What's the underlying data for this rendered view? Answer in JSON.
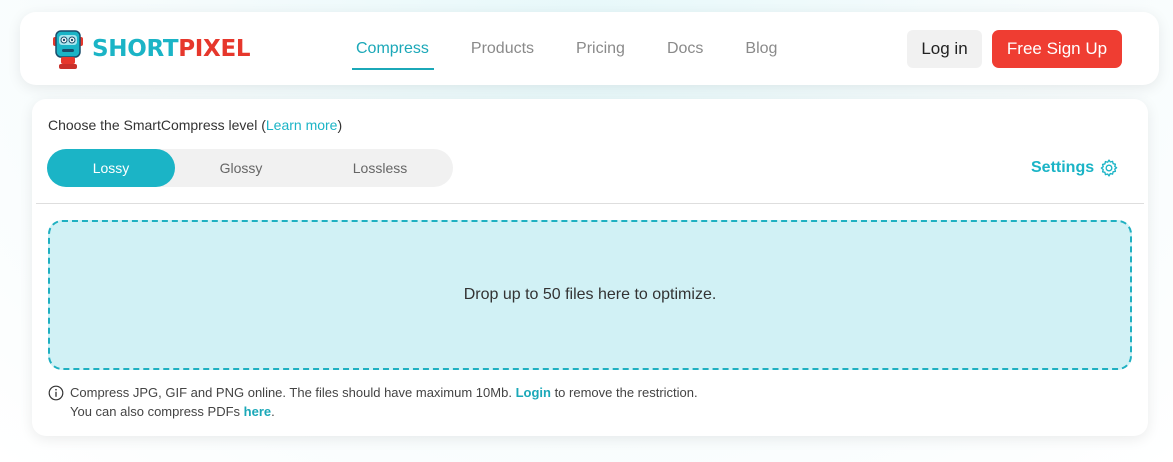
{
  "brand": {
    "name_part1": "SHORT",
    "name_part2": "PIXEL",
    "color_primary": "#1bb4c6",
    "color_accent": "#ef3d32"
  },
  "nav": {
    "items": [
      {
        "label": "Compress",
        "active": true
      },
      {
        "label": "Products",
        "active": false
      },
      {
        "label": "Pricing",
        "active": false
      },
      {
        "label": "Docs",
        "active": false
      },
      {
        "label": "Blog",
        "active": false
      }
    ]
  },
  "header_actions": {
    "login_label": "Log in",
    "signup_label": "Free Sign Up"
  },
  "compress": {
    "level_prefix": "Choose the SmartCompress level (",
    "learn_more": "Learn more",
    "level_suffix": ")",
    "levels": [
      {
        "label": "Lossy",
        "selected": true
      },
      {
        "label": "Glossy",
        "selected": false
      },
      {
        "label": "Lossless",
        "selected": false
      }
    ],
    "settings_label": "Settings",
    "settings_icon": "gear-icon",
    "dropzone_text": "Drop up to 50 files here to optimize.",
    "note": {
      "info_icon": "info-icon",
      "line1_before": "Compress JPG, GIF and PNG online. The files should have maximum 10Mb. ",
      "line1_link": "Login",
      "line1_after": " to remove the restriction.",
      "line2_before": "You can also compress PDFs ",
      "line2_link": "here",
      "line2_after": "."
    }
  }
}
